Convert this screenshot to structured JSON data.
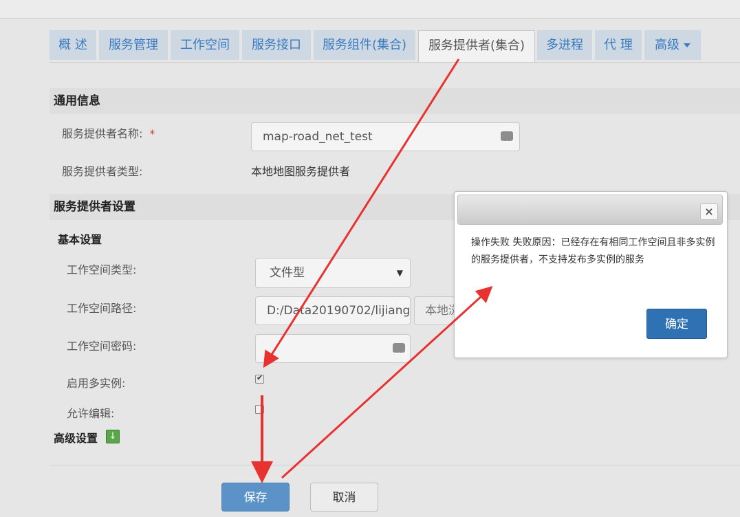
{
  "tabs": [
    {
      "label": "概 述"
    },
    {
      "label": "服务管理"
    },
    {
      "label": "工作空间"
    },
    {
      "label": "服务接口"
    },
    {
      "label": "服务组件(集合)"
    },
    {
      "label": "服务提供者(集合)"
    },
    {
      "label": "多进程"
    },
    {
      "label": "代 理"
    },
    {
      "label": "高级"
    }
  ],
  "general": {
    "heading": "通用信息",
    "name_label": "服务提供者名称:",
    "required_mark": "*",
    "name_value": "map-road_net_test",
    "type_label": "服务提供者类型:",
    "type_value": "本地地图服务提供者"
  },
  "provider_settings": {
    "heading": "服务提供者设置",
    "basic_heading": "基本设置",
    "workspace_type_label": "工作空间类型:",
    "workspace_type_value": "文件型",
    "workspace_path_label": "工作空间路径:",
    "workspace_path_value": "D:/Data20190702/lijiang",
    "local_browse_label": "本地浏",
    "workspace_password_label": "工作空间密码:",
    "multi_instance_label": "启用多实例:",
    "multi_instance_checked": true,
    "allow_edit_label": "允许编辑:",
    "allow_edit_checked": false,
    "advanced_heading": "高级设置"
  },
  "footer": {
    "save_label": "保存",
    "cancel_label": "取消"
  },
  "dialog": {
    "close_symbol": "×",
    "message": "操作失败 失败原因：已经存在有相同工作空间且非多实例的服务提供者，不支持发布多实例的服务",
    "ok_label": "确定"
  },
  "colors": {
    "accent": "#2f72b3",
    "annotation_arrow": "#e8322f"
  }
}
